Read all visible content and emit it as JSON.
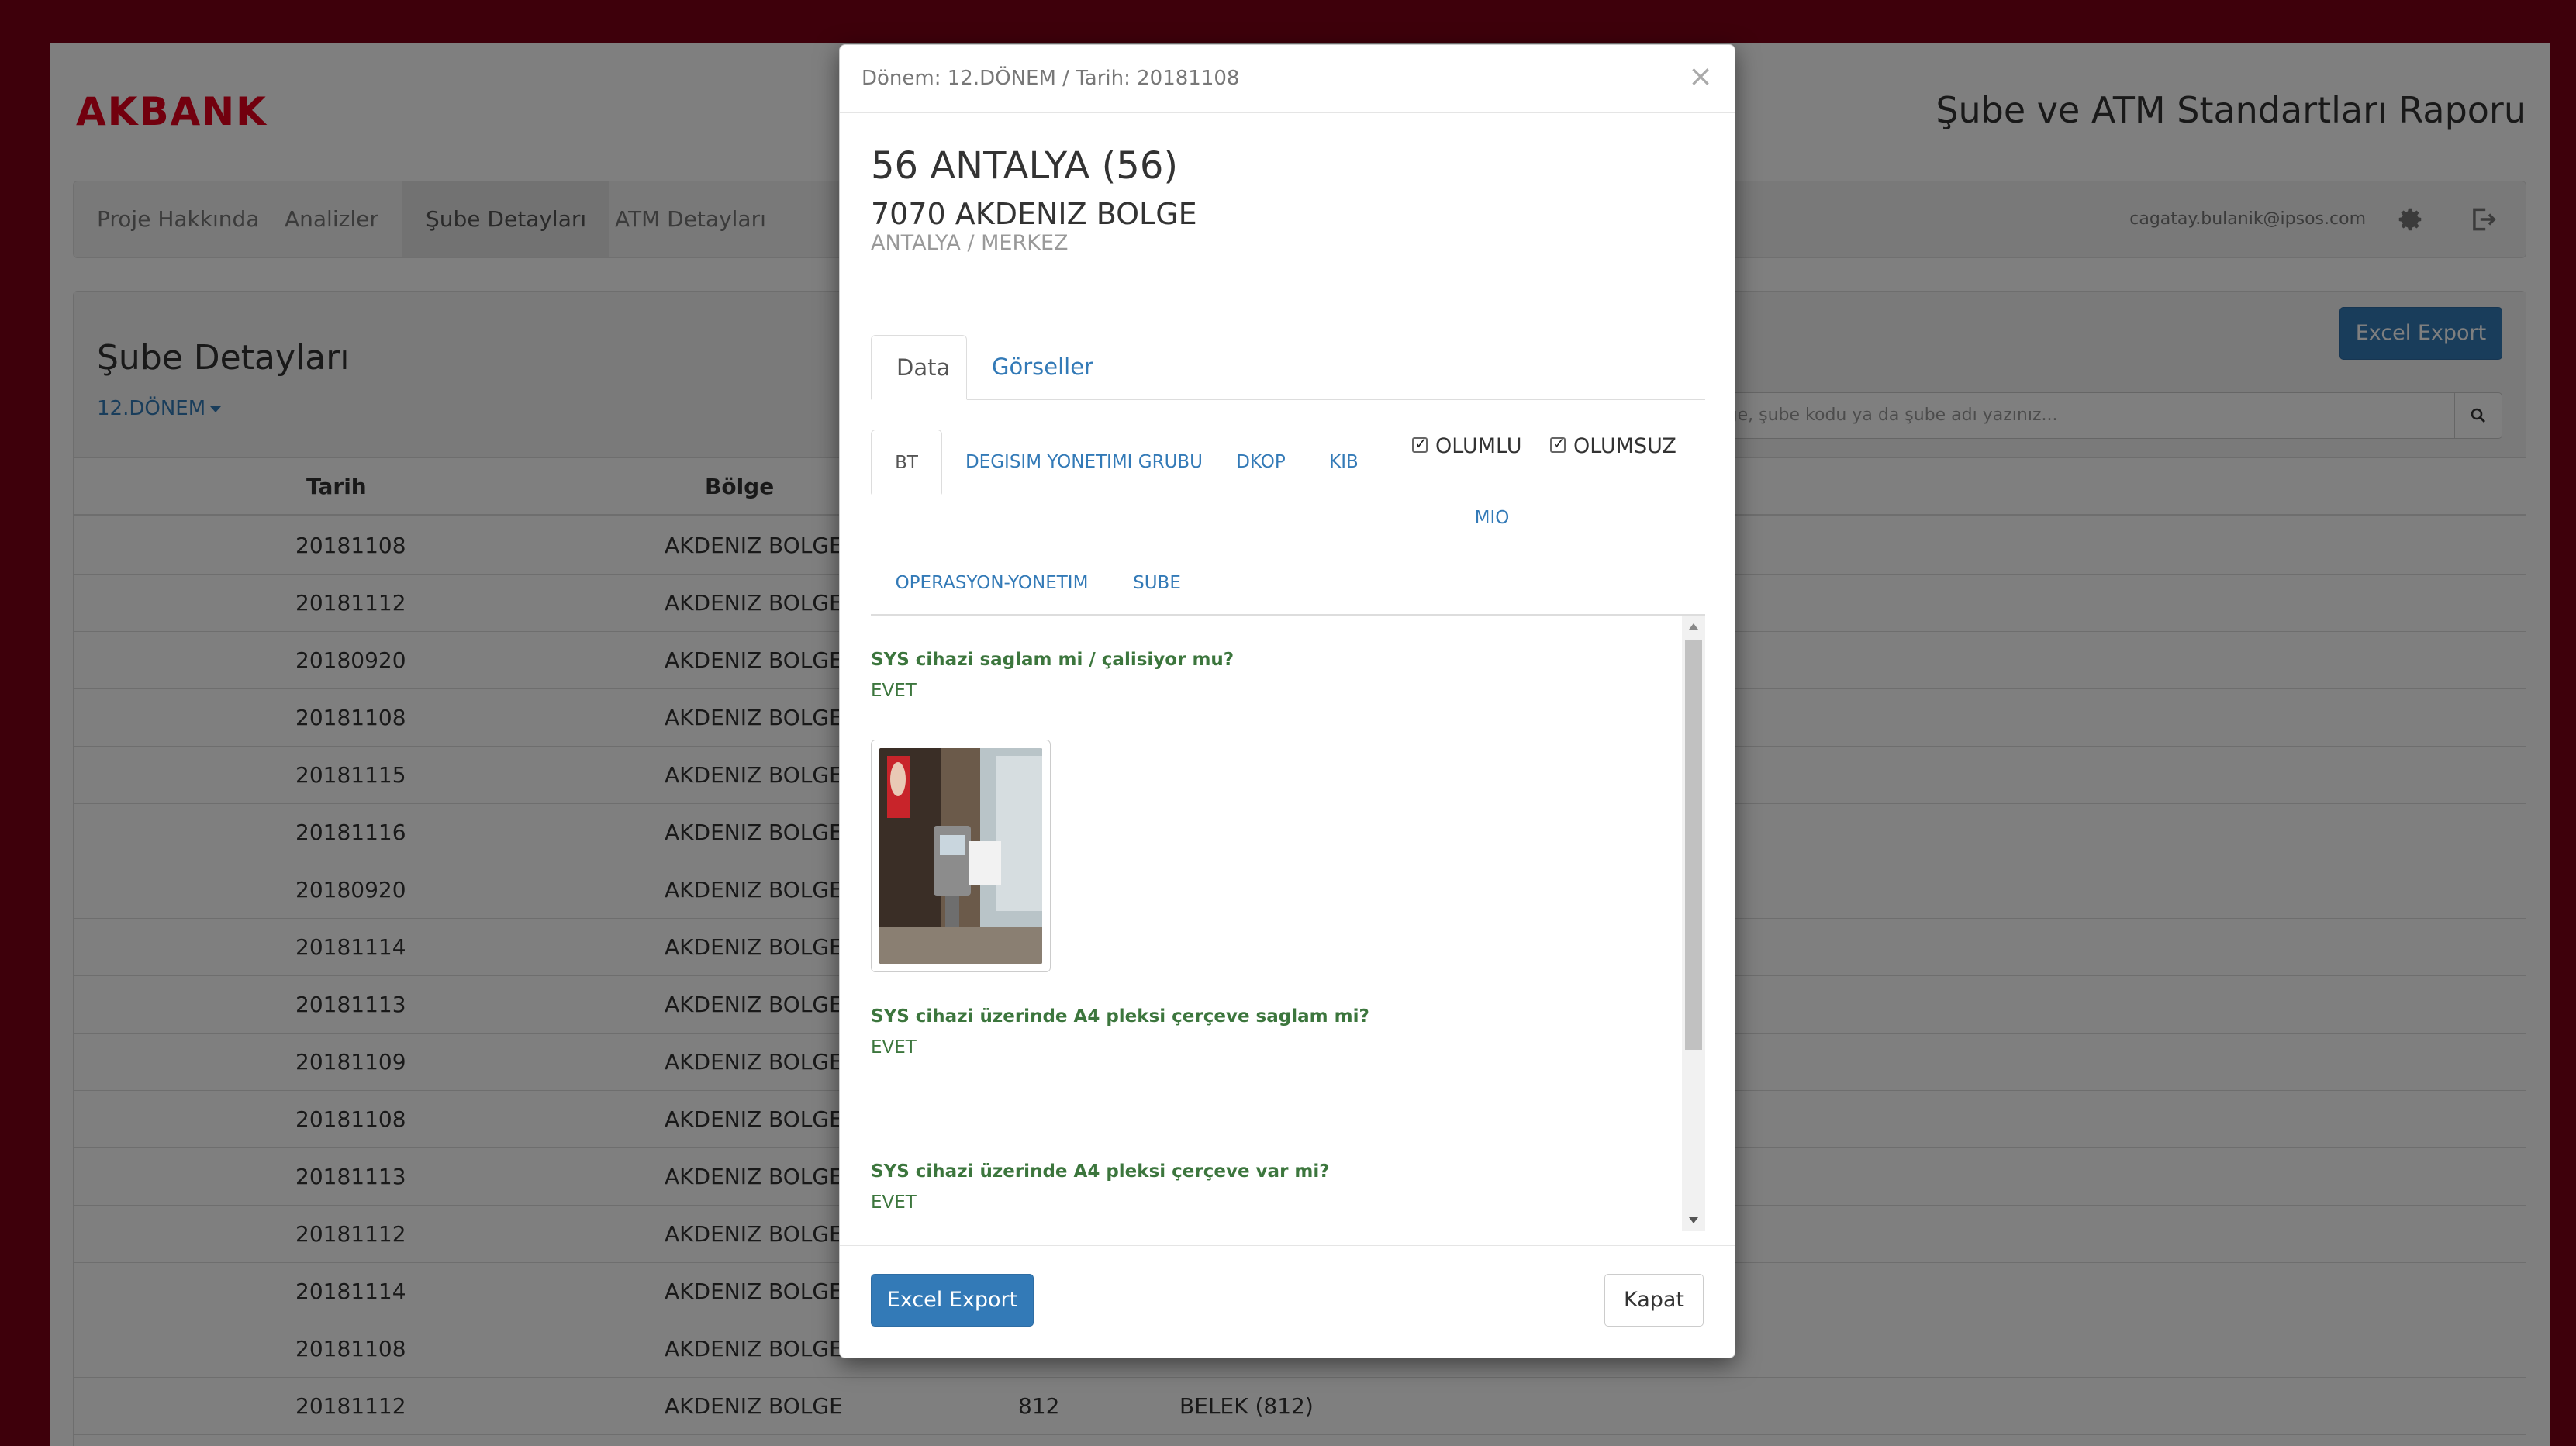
{
  "header": {
    "logo": "AKBANK",
    "app_title": "Şube ve ATM Standartları Raporu"
  },
  "nav": {
    "items": [
      "Proje Hakkında",
      "Analizler",
      "Şube Detayları",
      "ATM Detayları"
    ],
    "user": "cagatay.bulanik@ipsos.com"
  },
  "panel": {
    "title": "Şube Detayları",
    "period": "12.DÖNEM",
    "excel_label": "Excel Export",
    "search_placeholder": "Bölge, şube kodu ya da şube adı yazınız..."
  },
  "table": {
    "columns": [
      "Tarih",
      "Bölge"
    ],
    "rows": [
      [
        "20181108",
        "AKDENIZ BOLGE",
        "",
        ""
      ],
      [
        "20181112",
        "AKDENIZ BOLGE",
        "",
        ""
      ],
      [
        "20180920",
        "AKDENIZ BOLGE",
        "",
        ""
      ],
      [
        "20181108",
        "AKDENIZ BOLGE",
        "",
        ""
      ],
      [
        "20181115",
        "AKDENIZ BOLGE",
        "",
        ""
      ],
      [
        "20181116",
        "AKDENIZ BOLGE",
        "",
        ""
      ],
      [
        "20180920",
        "AKDENIZ BOLGE",
        "",
        ""
      ],
      [
        "20181114",
        "AKDENIZ BOLGE",
        "",
        ""
      ],
      [
        "20181113",
        "AKDENIZ BOLGE",
        "",
        ""
      ],
      [
        "20181109",
        "AKDENIZ BOLGE",
        "",
        ""
      ],
      [
        "20181108",
        "AKDENIZ BOLGE",
        "",
        ""
      ],
      [
        "20181113",
        "AKDENIZ BOLGE",
        "",
        ""
      ],
      [
        "20181112",
        "AKDENIZ BOLGE",
        "",
        ""
      ],
      [
        "20181114",
        "AKDENIZ BOLGE",
        "",
        ""
      ],
      [
        "20181108",
        "AKDENIZ BOLGE",
        "",
        ""
      ],
      [
        "20181112",
        "AKDENIZ BOLGE",
        "812",
        "BELEK (812)"
      ]
    ]
  },
  "modal": {
    "period_line": "Dönem: 12.DÖNEM / Tarih: 20181108",
    "close_glyph": "×",
    "branch_title": "56 ANTALYA (56)",
    "branch_region": "7070 AKDENIZ BOLGE",
    "branch_location": "ANTALYA / MERKEZ",
    "tabs": [
      "Data",
      "Görseller"
    ],
    "subtabs": [
      "BT",
      "DEGISIM YONETIMI GRUBU",
      "DKOP",
      "KIB",
      "MIO",
      "OPERASYON-YONETIM",
      "SUBE"
    ],
    "filters": {
      "positive": "OLUMLU",
      "negative": "OLUMSUZ"
    },
    "questions": [
      {
        "q": "SYS cihazi saglam mi / çalisiyor mu?",
        "a": "EVET"
      },
      {
        "q": "SYS cihazi üzerinde A4 pleksi çerçeve saglam mi?",
        "a": "EVET"
      },
      {
        "q": "SYS cihazi üzerinde A4 pleksi çerçeve var mi?",
        "a": "EVET"
      }
    ],
    "excel_label": "Excel Export",
    "close_label": "Kapat"
  },
  "colors": {
    "brand_red": "#e4001c",
    "frame": "#7c0016",
    "primary": "#337ab7",
    "answer_green": "#3c763d"
  }
}
